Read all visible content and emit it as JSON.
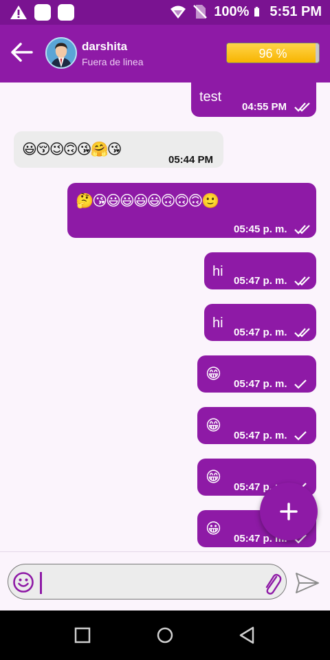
{
  "status_bar": {
    "battery_percent": "100%",
    "time": "5:51 PM",
    "icons": [
      "warning-icon",
      "app-icon",
      "app-icon",
      "wifi-icon",
      "no-sim-icon",
      "battery-icon"
    ]
  },
  "header": {
    "contact_name": "darshita",
    "contact_status": "Fuera de linea",
    "battery_label": "96 %",
    "battery_level": 96
  },
  "messages": [
    {
      "dir": "out",
      "text": "test",
      "time": "04:55 PM",
      "ticks": "double"
    },
    {
      "dir": "in",
      "text": "😃😚😉🙃😘🤗😘",
      "time": "05:44 PM",
      "ticks": "none"
    },
    {
      "dir": "out",
      "text": "🤔😘😃😃😃😃🙃🙃🙃🙂",
      "time": "05:45 p. m.",
      "ticks": "double"
    },
    {
      "dir": "out",
      "text": "hi",
      "time": "05:47 p. m.",
      "ticks": "double"
    },
    {
      "dir": "out",
      "text": "hi",
      "time": "05:47 p. m.",
      "ticks": "double"
    },
    {
      "dir": "out",
      "text": "😁",
      "time": "05:47 p. m.",
      "ticks": "single"
    },
    {
      "dir": "out",
      "text": "😁",
      "time": "05:47 p. m.",
      "ticks": "single"
    },
    {
      "dir": "out",
      "text": "😁",
      "time": "05:47 p. m.",
      "ticks": "single"
    },
    {
      "dir": "out",
      "text": "😀",
      "time": "05:47 p. m.",
      "ticks": "single"
    }
  ],
  "composer": {
    "input_value": "",
    "emoji_icon": "smiley-icon",
    "attach_icon": "paperclip-icon",
    "send_icon": "send-icon"
  },
  "fab_icon": "plus-icon",
  "colors": {
    "primary": "#8e1aa6",
    "status_bar": "#7a1391",
    "incoming_bubble": "#ececec",
    "background": "#fbf4fc",
    "battery_fill": "#f7b400"
  }
}
